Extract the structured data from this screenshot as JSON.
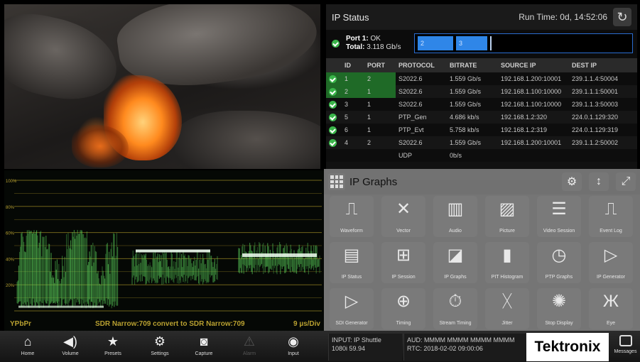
{
  "ip_status": {
    "title": "IP Status",
    "run_time": "Run Time: 0d, 14:52:06",
    "port": {
      "label": "Port 1:",
      "status": "OK",
      "total_label": "Total:",
      "total_value": "3.118 Gb/s",
      "segments": [
        "2",
        "3"
      ]
    },
    "columns": [
      "ID",
      "PORT",
      "PROTOCOL",
      "BITRATE",
      "SOURCE IP",
      "DEST IP"
    ],
    "rows": [
      {
        "ok": true,
        "id": "1",
        "port": "2",
        "protocol": "S2022.6",
        "bitrate": "1.559 Gb/s",
        "source": "192.168.1.200:10001",
        "dest": "239.1.1.4:50004"
      },
      {
        "ok": true,
        "id": "2",
        "port": "1",
        "protocol": "S2022.6",
        "bitrate": "1.559 Gb/s",
        "source": "192.168.1.100:10000",
        "dest": "239.1.1.1:50001"
      },
      {
        "ok": true,
        "id": "3",
        "port": "1",
        "protocol": "S2022.6",
        "bitrate": "1.559 Gb/s",
        "source": "192.168.1.100:10000",
        "dest": "239.1.1.3:50003"
      },
      {
        "ok": true,
        "id": "5",
        "port": "1",
        "protocol": "PTP_Gen",
        "bitrate": "4.686 kb/s",
        "source": "192.168.1.2:320",
        "dest": "224.0.1.129:320"
      },
      {
        "ok": true,
        "id": "6",
        "port": "1",
        "protocol": "PTP_Evt",
        "bitrate": "5.758 kb/s",
        "source": "192.168.1.2:319",
        "dest": "224.0.1.129:319"
      },
      {
        "ok": true,
        "id": "4",
        "port": "2",
        "protocol": "S2022.6",
        "bitrate": "1.559 Gb/s",
        "source": "192.168.1.200:10001",
        "dest": "239.1.1.2:50002"
      },
      {
        "ok": false,
        "id": "",
        "port": "",
        "protocol": "UDP",
        "bitrate": "0b/s",
        "source": "",
        "dest": ""
      }
    ]
  },
  "ip_graphs": {
    "title": "IP Graphs",
    "tiles": [
      {
        "label": "Waveform",
        "icon": "waveform-icon",
        "glyph": "⎍"
      },
      {
        "label": "Vector",
        "icon": "vector-icon",
        "glyph": "✕"
      },
      {
        "label": "Audio",
        "icon": "audio-icon",
        "glyph": "▥"
      },
      {
        "label": "Picture",
        "icon": "picture-icon",
        "glyph": "▨"
      },
      {
        "label": "Video Session",
        "icon": "video-session-icon",
        "glyph": "☰"
      },
      {
        "label": "Event Log",
        "icon": "event-log-icon",
        "glyph": "⎍"
      },
      {
        "label": "IP Status",
        "icon": "ip-status-icon",
        "glyph": "▤"
      },
      {
        "label": "IP Session",
        "icon": "ip-session-icon",
        "glyph": "⊞"
      },
      {
        "label": "IP Graphs",
        "icon": "ip-graphs-icon",
        "glyph": "◪"
      },
      {
        "label": "PIT Histogram",
        "icon": "pit-histogram-icon",
        "glyph": "▮"
      },
      {
        "label": "PTP Graphs",
        "icon": "ptp-graphs-icon",
        "glyph": "◷"
      },
      {
        "label": "IP Generator",
        "icon": "ip-generator-icon",
        "glyph": "▷"
      },
      {
        "label": "SDI Generator",
        "icon": "sdi-generator-icon",
        "glyph": "▷"
      },
      {
        "label": "Timing",
        "icon": "timing-icon",
        "glyph": "⊕"
      },
      {
        "label": "Stream Timing",
        "icon": "stream-timing-icon",
        "glyph": "⏱"
      },
      {
        "label": "Jitter",
        "icon": "jitter-icon",
        "glyph": "ᚷ"
      },
      {
        "label": "Stop Display",
        "icon": "stop-display-icon",
        "glyph": "✺"
      },
      {
        "label": "Eye",
        "icon": "eye-icon",
        "glyph": "Ж"
      }
    ]
  },
  "waveform": {
    "format": "YPbPr",
    "conversion": "SDR Narrow:709 convert to SDR Narrow:709",
    "timebase": "9 µs/Div",
    "y_ticks": [
      "100%",
      "80%",
      "60%",
      "40%",
      "20%"
    ]
  },
  "bottom_bar": {
    "nav": [
      {
        "label": "Home",
        "icon": "home-icon",
        "glyph": "⌂",
        "enabled": true
      },
      {
        "label": "Volume",
        "icon": "volume-icon",
        "glyph": "◀)",
        "enabled": true
      },
      {
        "label": "Presets",
        "icon": "star-icon",
        "glyph": "★",
        "enabled": true
      },
      {
        "label": "Settings",
        "icon": "gear-icon",
        "glyph": "⚙",
        "enabled": true
      },
      {
        "label": "Capture",
        "icon": "camera-icon",
        "glyph": "◙",
        "enabled": true
      },
      {
        "label": "Alarm",
        "icon": "alarm-icon",
        "glyph": "⚠",
        "enabled": false
      },
      {
        "label": "Input",
        "icon": "input-icon",
        "glyph": "◉",
        "enabled": true
      }
    ],
    "input_line1": "INPUT: IP Shuttle",
    "input_line2": "1080i 59.94",
    "aud_line": "AUD: MMMM MMMM MMMM MMMM",
    "rtc_line": "RTC: 2018-02-02 09:00:06",
    "brand": "Tektronix",
    "messages_label": "Messages"
  },
  "colors": {
    "trace_green": "#5bd25b",
    "graticule": "#8a7a20",
    "accent_blue": "#2f86e8",
    "ok_green": "#3ab54a"
  }
}
